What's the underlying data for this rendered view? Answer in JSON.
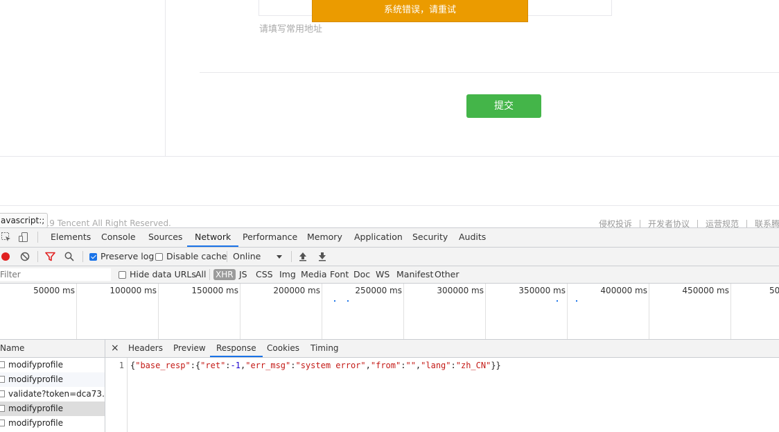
{
  "page": {
    "hint": "请填写常用地址",
    "toast": "系统错误，请重试",
    "submit_label": "提交",
    "copyright": "019 Tencent All Right Reserved.",
    "footer_links": [
      "侵权投诉",
      "开发者协议",
      "运营规范",
      "联系腾"
    ],
    "status_tooltip": "avascript:;"
  },
  "devtools": {
    "tabs": [
      "Elements",
      "Console",
      "Sources",
      "Network",
      "Performance",
      "Memory",
      "Application",
      "Security",
      "Audits"
    ],
    "active_tab": "Network",
    "toolbar": {
      "preserve_log": "Preserve log",
      "preserve_log_checked": true,
      "disable_cache": "Disable cache",
      "disable_cache_checked": false,
      "throttling": "Online"
    },
    "filter": {
      "placeholder": "Filter",
      "hide_data_urls": "Hide data URLs",
      "types": [
        "All",
        "XHR",
        "JS",
        "CSS",
        "Img",
        "Media",
        "Font",
        "Doc",
        "WS",
        "Manifest",
        "Other"
      ],
      "active_type": "XHR"
    },
    "timeline_ticks": [
      "50000 ms",
      "100000 ms",
      "150000 ms",
      "200000 ms",
      "250000 ms",
      "300000 ms",
      "350000 ms",
      "400000 ms",
      "450000 ms",
      "50"
    ],
    "requests": {
      "header": "Name",
      "rows": [
        "modifyprofile",
        "modifyprofile",
        "validate?token=dca73…",
        "modifyprofile",
        "modifyprofile"
      ],
      "selected_index": 3
    },
    "detail": {
      "close": "×",
      "tabs": [
        "Headers",
        "Preview",
        "Response",
        "Cookies",
        "Timing"
      ],
      "active_tab": "Response",
      "line_number": "1",
      "response": {
        "base_resp_key": "\"base_resp\"",
        "ret_key": "\"ret\"",
        "ret_value": "-1",
        "err_msg_key": "\"err_msg\"",
        "err_msg_value": "\"system error\"",
        "from_key": "\"from\"",
        "from_value": "\"\"",
        "lang_key": "\"lang\"",
        "lang_value": "\"zh_CN\""
      }
    }
  }
}
